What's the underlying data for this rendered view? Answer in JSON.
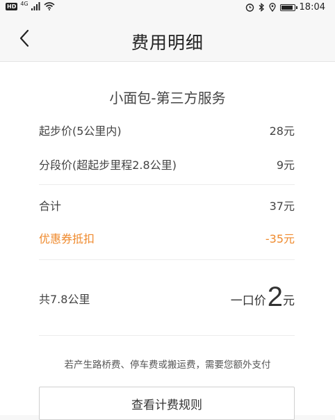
{
  "status_bar": {
    "hd": "HD",
    "network": "4G",
    "time": "18:04"
  },
  "header": {
    "title": "费用明细"
  },
  "service": {
    "name": "小面包-第三方服务"
  },
  "fees": [
    {
      "label": "起步价(5公里内)",
      "amount": "28元"
    },
    {
      "label": "分段价(超起步里程2.8公里)",
      "amount": "9元"
    }
  ],
  "subtotal": {
    "label": "合计",
    "amount": "37元"
  },
  "discount": {
    "label": "优惠券抵扣",
    "amount": "-35元",
    "color": "#ef8a2d"
  },
  "total": {
    "distance": "共7.8公里",
    "price_prefix": "一口价",
    "price_value": "2",
    "price_unit": "元"
  },
  "note": "若产生路桥费、停车费或搬运费，需要您额外支付",
  "rules_button": "查看计费规则"
}
